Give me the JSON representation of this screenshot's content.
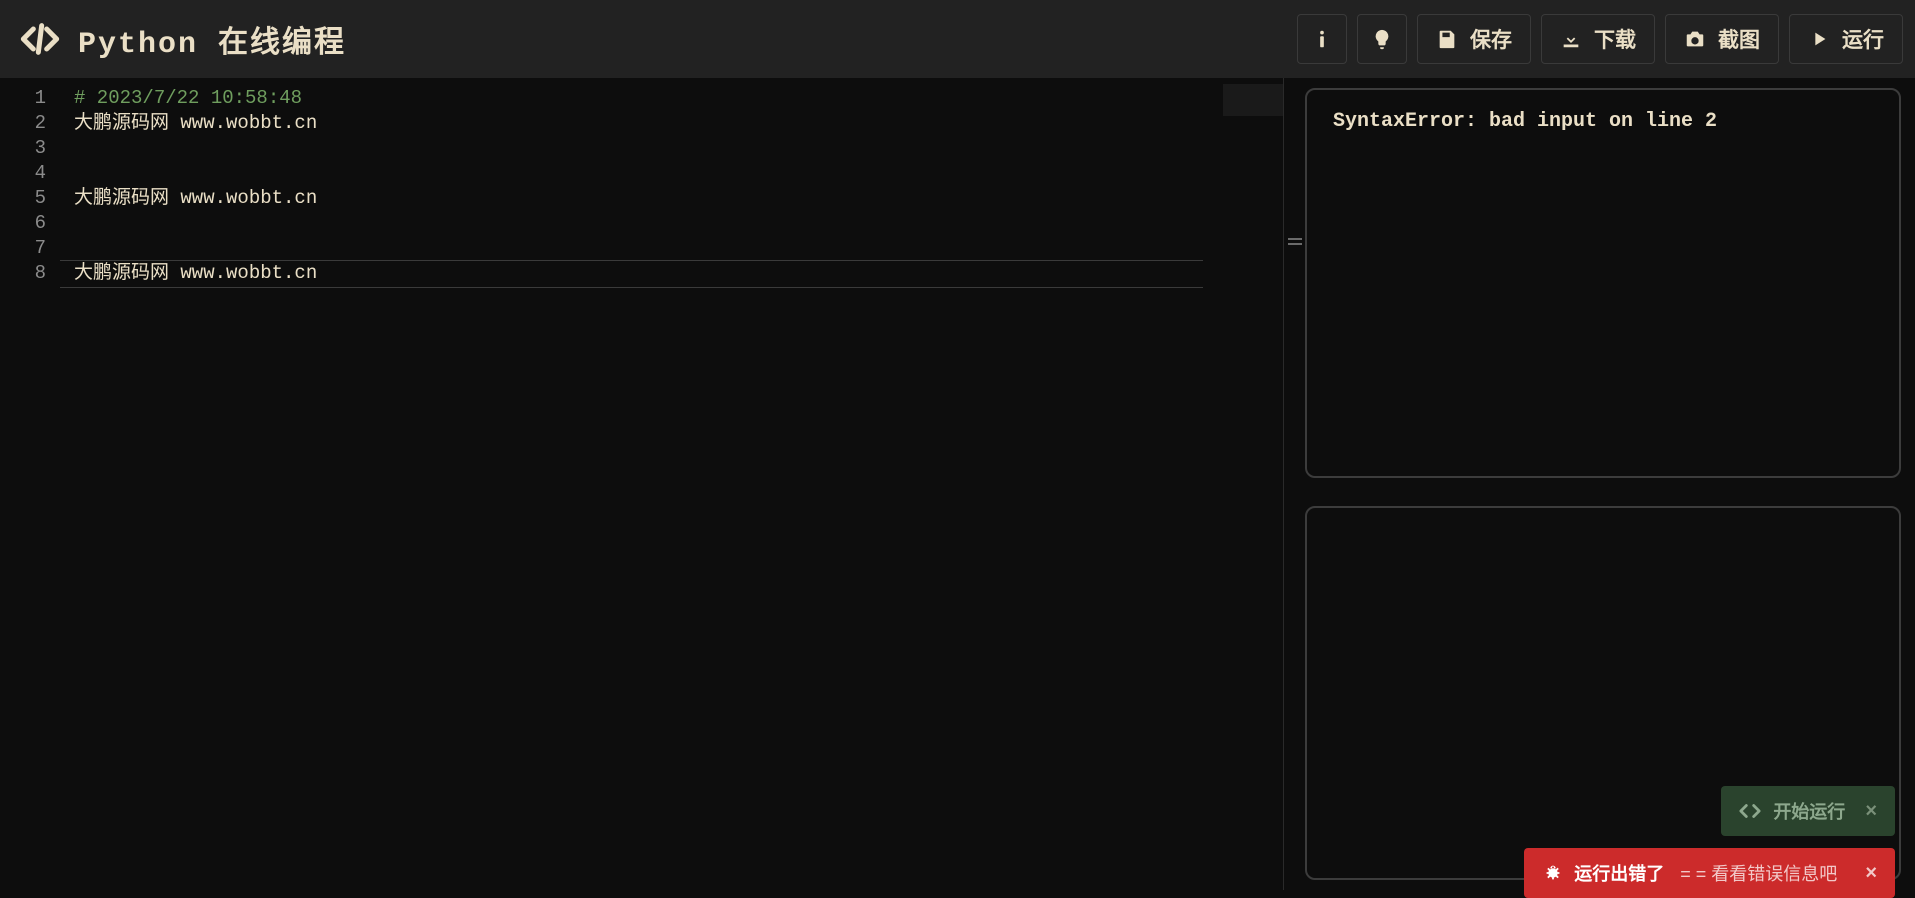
{
  "header": {
    "title": "Python 在线编程",
    "buttons": {
      "save": "保存",
      "download": "下载",
      "screenshot": "截图",
      "run": "运行"
    }
  },
  "editor": {
    "lines": [
      {
        "n": 1,
        "text": "# 2023/7/22 10:58:48",
        "cls": "comment"
      },
      {
        "n": 2,
        "text": "大鹏源码网 www.wobbt.cn",
        "cls": ""
      },
      {
        "n": 3,
        "text": "",
        "cls": ""
      },
      {
        "n": 4,
        "text": "",
        "cls": ""
      },
      {
        "n": 5,
        "text": "大鹏源码网 www.wobbt.cn",
        "cls": ""
      },
      {
        "n": 6,
        "text": "",
        "cls": ""
      },
      {
        "n": 7,
        "text": "",
        "cls": ""
      },
      {
        "n": 8,
        "text": "大鹏源码网 www.wobbt.cn",
        "cls": "active"
      }
    ]
  },
  "output": {
    "text": "SyntaxError: bad input on line 2"
  },
  "toast": {
    "run_label": "开始运行",
    "error_label": "运行出错了",
    "error_detail": "= = 看看错误信息吧"
  }
}
